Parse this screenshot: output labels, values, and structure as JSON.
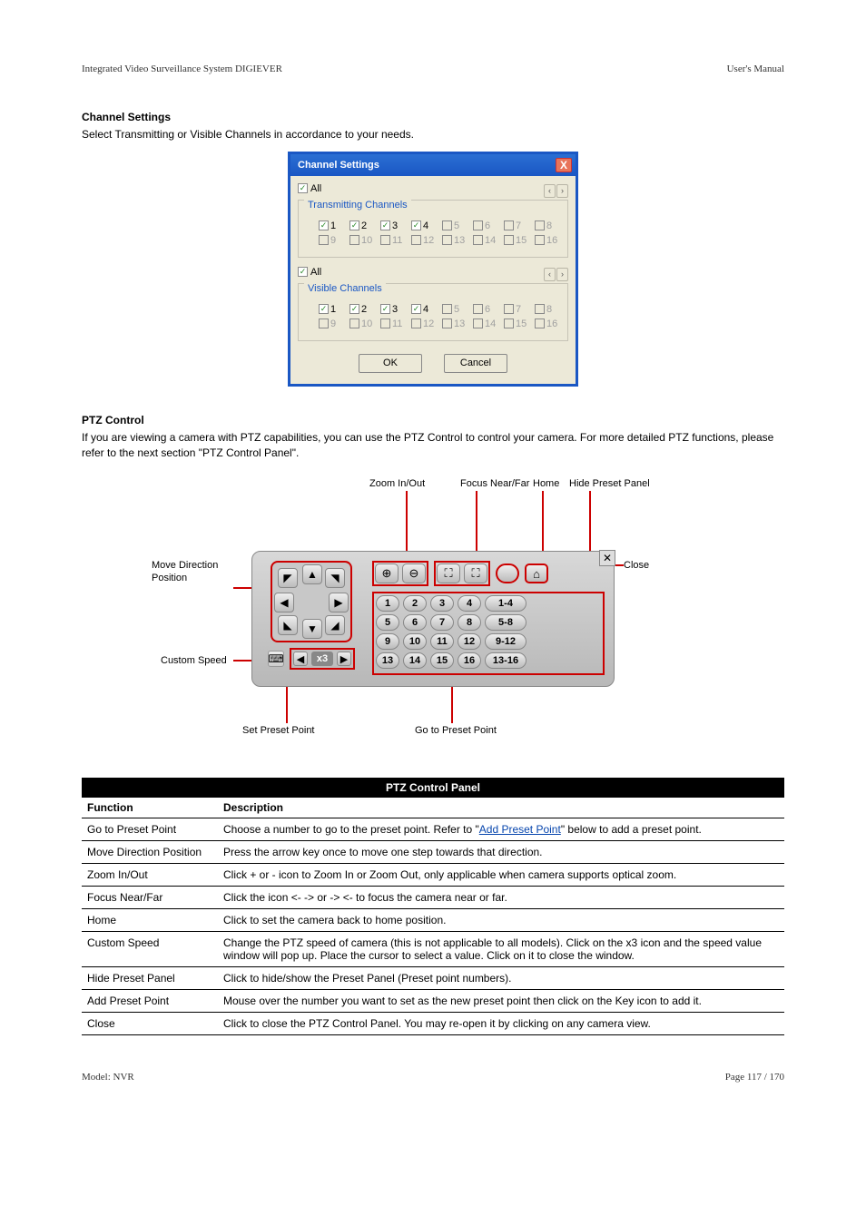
{
  "header": {
    "left": "Integrated Video Surveillance System DIGIEVER",
    "right": "User's Manual"
  },
  "sec1": {
    "title": "Channel Settings",
    "text": "Select Transmitting or Visible Channels in accordance to your needs."
  },
  "dialog": {
    "title": "Channel Settings",
    "close": "X",
    "all": "All",
    "group1": "Transmitting Channels",
    "group2": "Visible Channels",
    "nav_prev": "‹",
    "nav_next": "›",
    "row1": [
      {
        "n": "1",
        "c": true,
        "e": true
      },
      {
        "n": "2",
        "c": true,
        "e": true
      },
      {
        "n": "3",
        "c": true,
        "e": true
      },
      {
        "n": "4",
        "c": true,
        "e": true
      },
      {
        "n": "5",
        "c": false,
        "e": false
      },
      {
        "n": "6",
        "c": false,
        "e": false
      },
      {
        "n": "7",
        "c": false,
        "e": false
      },
      {
        "n": "8",
        "c": false,
        "e": false
      }
    ],
    "row2": [
      {
        "n": "9",
        "c": false,
        "e": false
      },
      {
        "n": "10",
        "c": false,
        "e": false
      },
      {
        "n": "11",
        "c": false,
        "e": false
      },
      {
        "n": "12",
        "c": false,
        "e": false
      },
      {
        "n": "13",
        "c": false,
        "e": false
      },
      {
        "n": "14",
        "c": false,
        "e": false
      },
      {
        "n": "15",
        "c": false,
        "e": false
      },
      {
        "n": "16",
        "c": false,
        "e": false
      }
    ],
    "ok": "OK",
    "cancel": "Cancel"
  },
  "sec2": {
    "title": "PTZ Control",
    "text": "If you are viewing a camera with PTZ capabilities, you can use the PTZ Control to control your camera. For more detailed PTZ functions, please refer to the next section \"PTZ Control Panel\"."
  },
  "ptz": {
    "speed": "x3",
    "nums": [
      "1",
      "2",
      "3",
      "4",
      "5",
      "6",
      "7",
      "8",
      "9",
      "10",
      "11",
      "12",
      "13",
      "14",
      "15",
      "16"
    ],
    "ranges": [
      "1-4",
      "5-8",
      "9-12",
      "13-16"
    ],
    "close": "✕",
    "zoom_in": "⊕",
    "zoom_out": "⊖",
    "focus_near": "⛶",
    "focus_far": "⛶",
    "home": "⌂"
  },
  "callouts": {
    "top": [
      "Zoom In/Out",
      "Focus Near/Far",
      "Home",
      "Hide Preset Panel"
    ],
    "left": [
      "Move Direction",
      "Position",
      "Custom Speed"
    ],
    "bottom": [
      "Set Preset Point",
      "Go to Preset Point"
    ],
    "right": "Close"
  },
  "table": {
    "caption": "PTZ Control Panel",
    "col1": "Function",
    "col2": "Description",
    "rows": [
      [
        "Go to Preset Point",
        "Choose a number to go to the preset point. Refer to \"Add Preset Point\" below to add a preset point."
      ],
      [
        "Move Direction Position",
        "Press the arrow key once to move one step towards that direction."
      ],
      [
        "Zoom In/Out",
        "Click + or - icon to Zoom In or Zoom Out, only applicable when camera supports optical zoom."
      ],
      [
        "Focus Near/Far",
        "Click the icon <- -> or -> <- to focus the camera near or far."
      ],
      [
        "Home",
        "Click to set the camera back to home position."
      ],
      [
        "Custom Speed",
        "Change the PTZ speed of camera (this is not applicable to all models). Click on the x3 icon and the speed value window will pop up. Place the cursor to select a value. Click on it to close the window."
      ],
      [
        "Hide Preset Panel",
        "Click to hide/show the Preset Panel (Preset point numbers)."
      ],
      [
        "Add Preset Point",
        "Mouse over the number you want to set as the new preset point then click on the Key icon to add it."
      ],
      [
        "Close",
        "Click to close the PTZ Control Panel. You may re-open it by clicking on any camera view."
      ]
    ]
  },
  "footer": {
    "left": "Model: NVR",
    "right": "Page 117 / 170"
  }
}
